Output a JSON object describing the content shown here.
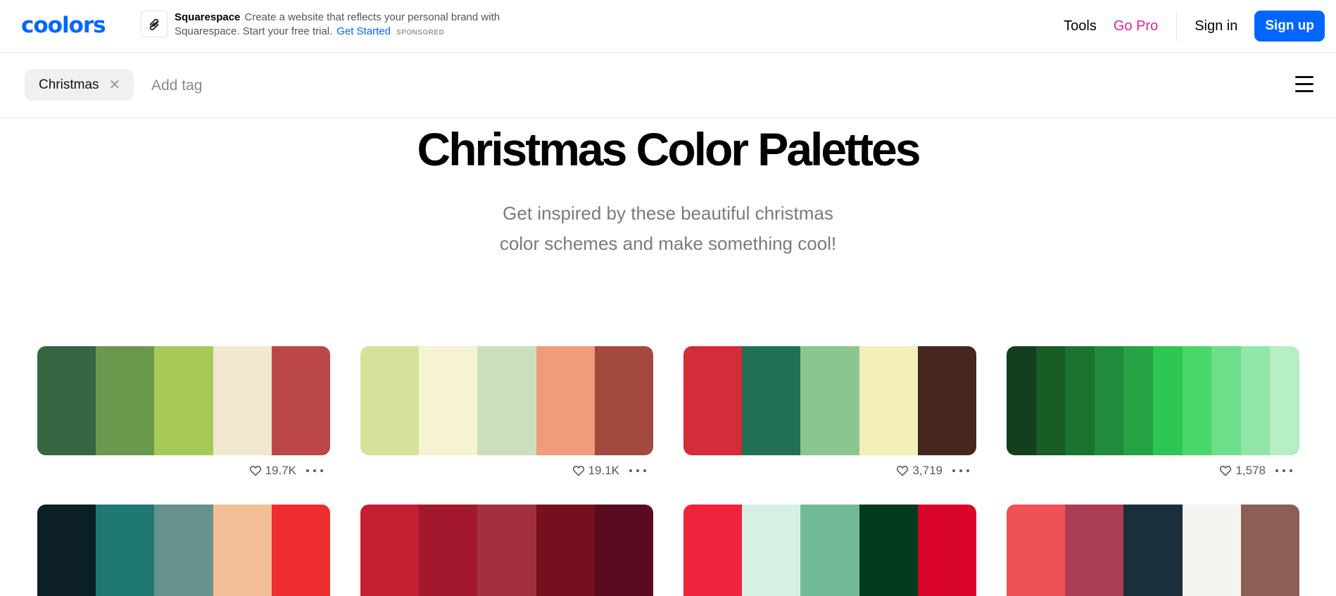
{
  "header": {
    "logo": "coolors",
    "ad": {
      "brand": "Squarespace",
      "text": "Create a website that reflects your personal brand with Squarespace. Start your free trial.",
      "cta": "Get Started",
      "sponsored": "SPONSORED"
    },
    "nav": {
      "tools": "Tools",
      "go_pro": "Go Pro",
      "sign_in": "Sign in",
      "sign_up": "Sign up"
    }
  },
  "tagbar": {
    "tag": "Christmas",
    "remove_glyph": "✕",
    "input_placeholder": "Add tag"
  },
  "hero": {
    "title": "Christmas Color Palettes",
    "subtitle_line1": "Get inspired by these beautiful christmas",
    "subtitle_line2": "color schemes and make something cool!"
  },
  "palettes": [
    {
      "colors": [
        "#356641",
        "#6a994e",
        "#a7c957",
        "#f2e8cf",
        "#bc4749"
      ],
      "likes": "19.7K"
    },
    {
      "colors": [
        "#d6e29a",
        "#f6f3d2",
        "#cbdfbd",
        "#f09c7b",
        "#a3493e"
      ],
      "likes": "19.1K"
    },
    {
      "colors": [
        "#d62b38",
        "#227157",
        "#8bc690",
        "#f2efb8",
        "#452720"
      ],
      "likes": "3,719"
    },
    {
      "colors": [
        "#143f1f",
        "#185c26",
        "#1a7430",
        "#208b3a",
        "#25a243",
        "#2dc653",
        "#4ad76a",
        "#6ede8a",
        "#92e6a7",
        "#b7efc5"
      ],
      "likes": "1,578"
    },
    {
      "colors": [
        "#0b1f24",
        "#1f7874",
        "#66928b",
        "#f2bf96",
        "#ef2e31"
      ],
      "likes": ""
    },
    {
      "colors": [
        "#c31e32",
        "#a2192d",
        "#a33040",
        "#75111f",
        "#590b1f"
      ],
      "likes": ""
    },
    {
      "colors": [
        "#ef233c",
        "#d6f0e4",
        "#72b99a",
        "#003b1f",
        "#d90429"
      ],
      "likes": ""
    },
    {
      "colors": [
        "#f05159",
        "#aa3d52",
        "#1b2e3c",
        "#f3f4ed",
        "#8c5e58"
      ],
      "likes": ""
    }
  ],
  "icons": {
    "heart": "heart-icon",
    "more": "more-icon",
    "menu": "hamburger-menu-icon"
  }
}
